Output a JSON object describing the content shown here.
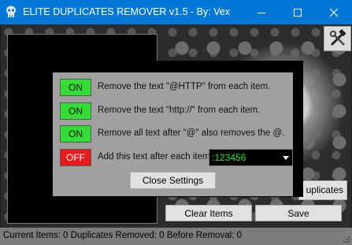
{
  "window": {
    "title": "ELITE DUPLICATES REMOVER v1.5 - By: Vex",
    "icons": {
      "app": "skull-icon",
      "minimize": "minimize-icon",
      "maximize": "maximize-icon",
      "close": "close-icon"
    }
  },
  "main": {
    "tools_icon": "hammer-wrench-icon",
    "duplicates_label": "uplicates",
    "clear_label": "Clear Items",
    "save_label": "Save"
  },
  "settings": {
    "rows": [
      {
        "state": "ON",
        "label": "Remove the text \"@HTTP\" from each item."
      },
      {
        "state": "ON",
        "label": "Remove the text \"http://\" from each item."
      },
      {
        "state": "ON",
        "label": "Remove all text after  \"@\" also removes the @."
      },
      {
        "state": "OFF",
        "label": "Add this text after each item"
      }
    ],
    "suffix_value": ":123456",
    "close_label": "Close Settings"
  },
  "status": {
    "text": "Current Items: 0  Duplicates Removed: 0  Before Removal: 0"
  },
  "colors": {
    "titlebar": "#0078d7",
    "on": "#33dd33",
    "off": "#e81a1a",
    "combo_text": "#2ee62e"
  }
}
